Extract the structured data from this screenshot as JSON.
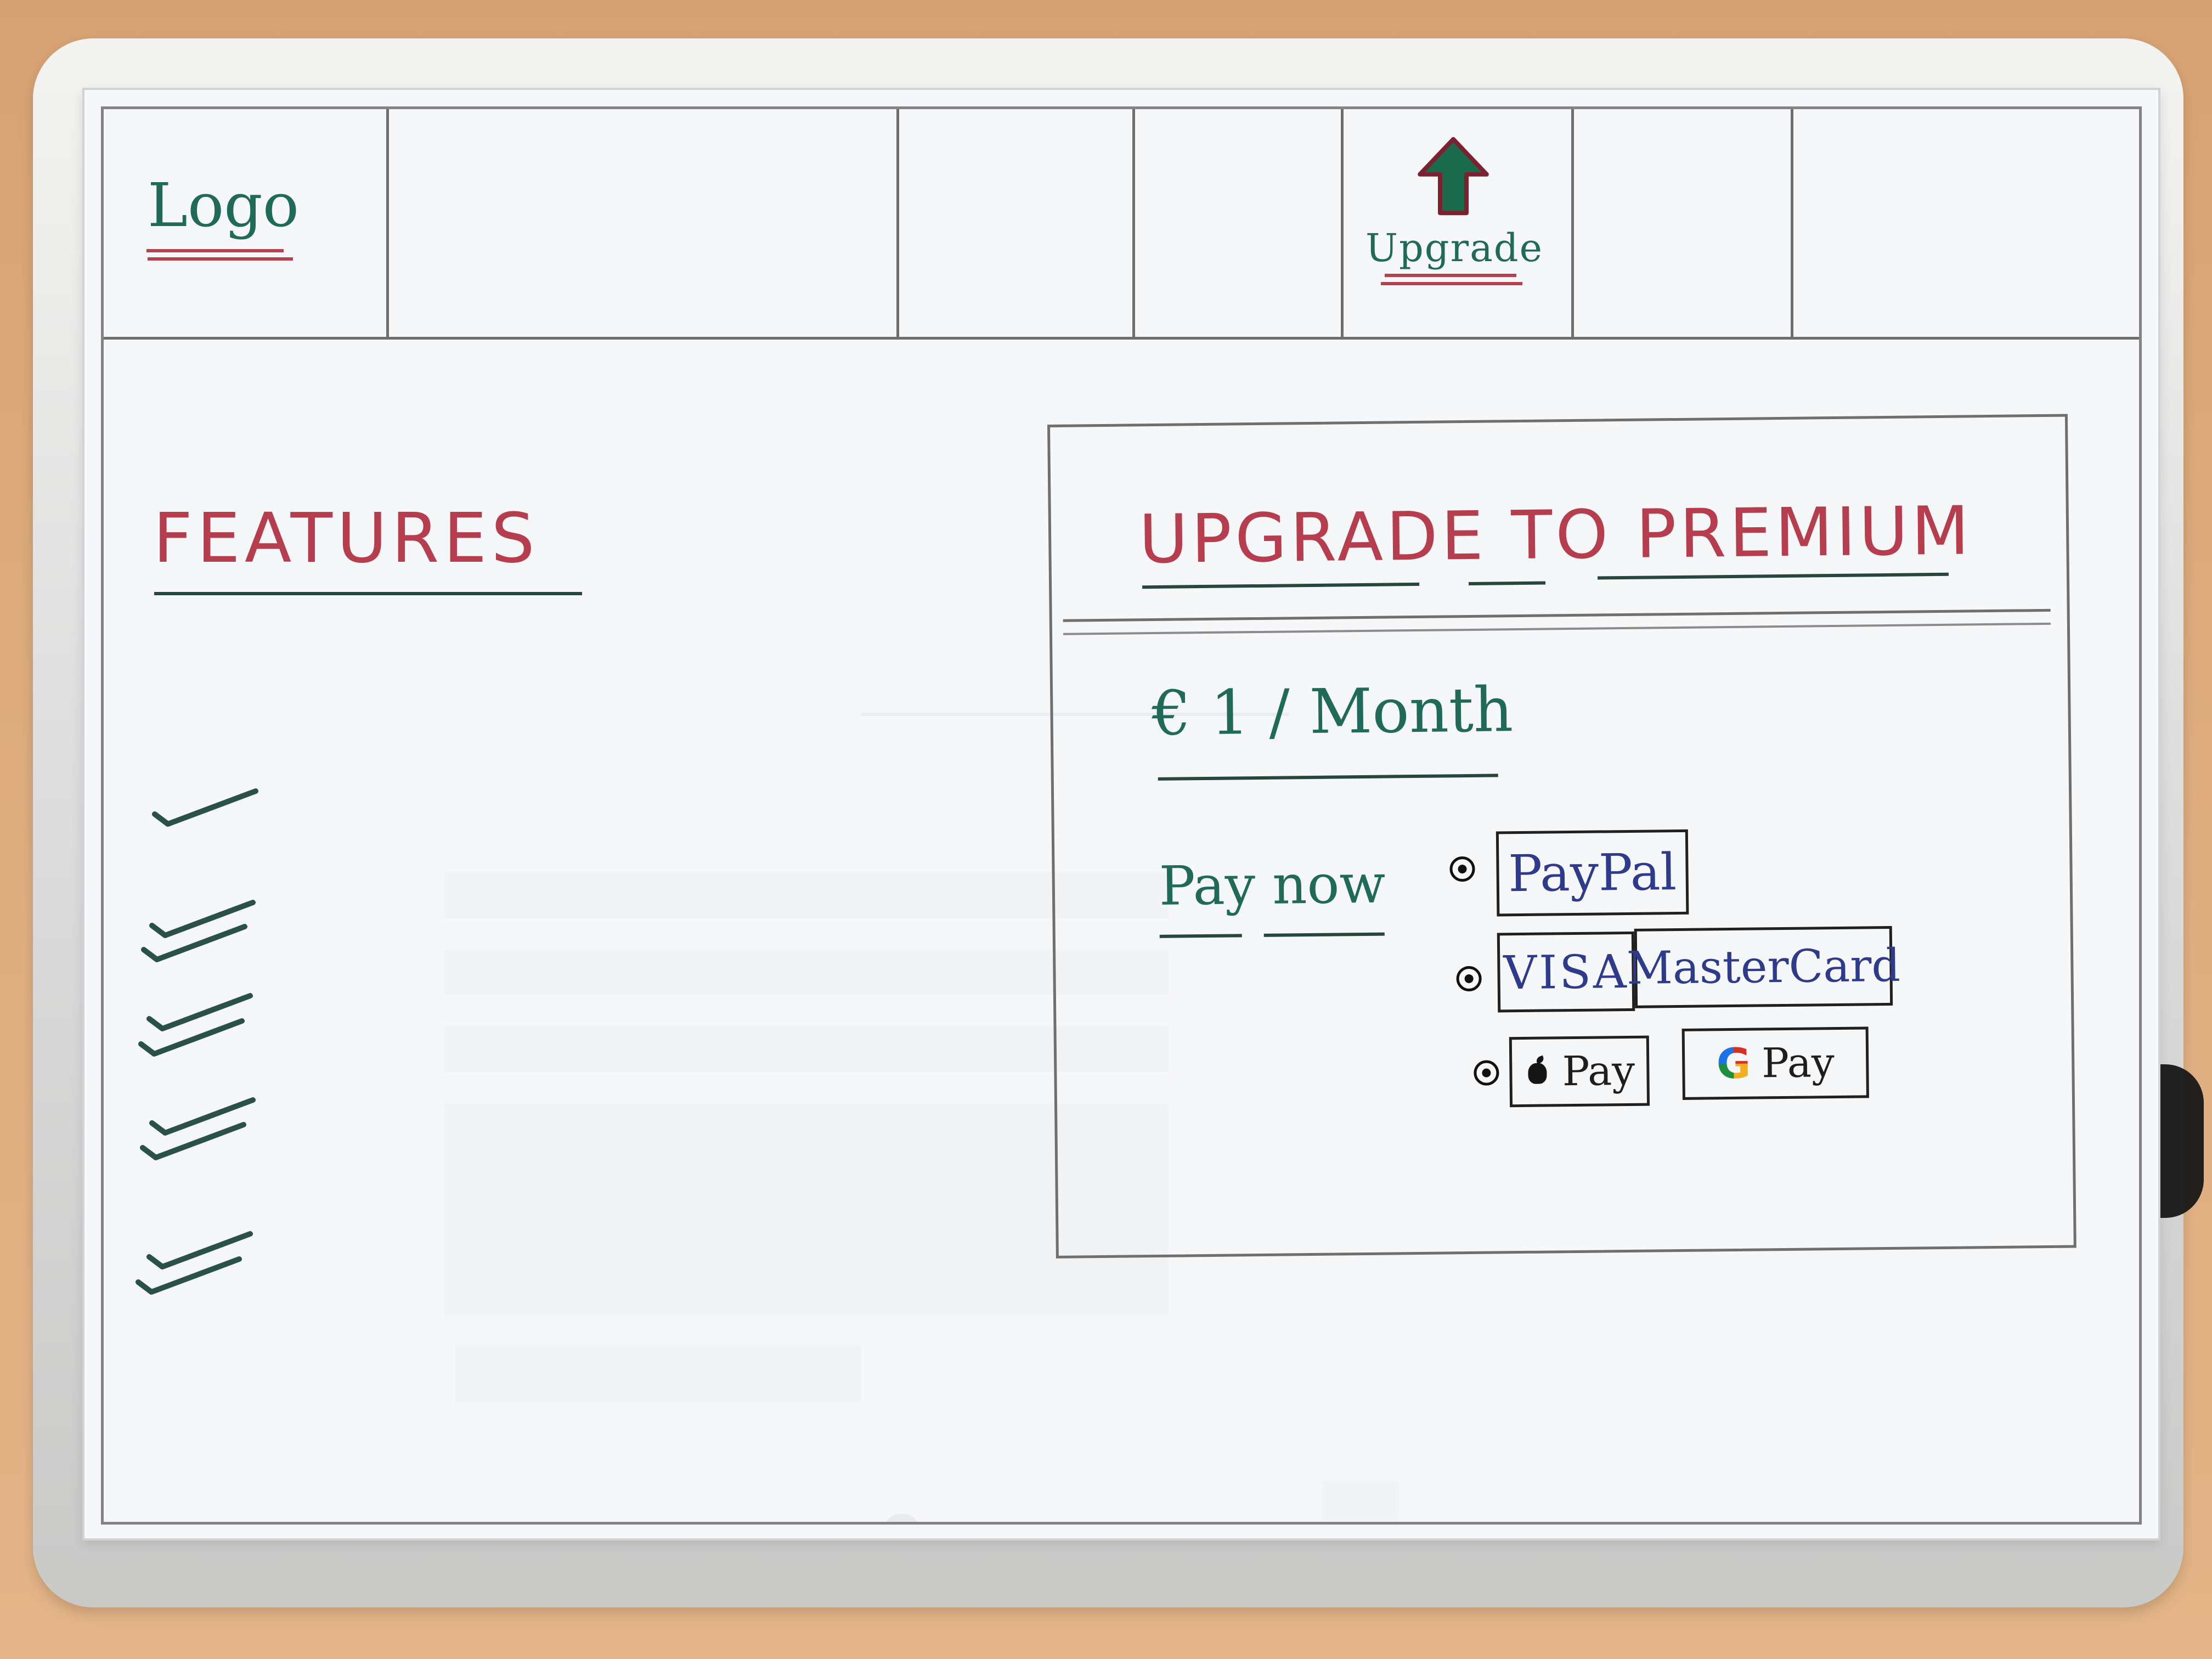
{
  "header": {
    "logo": "Logo",
    "upgrade_label": "Upgrade",
    "upgrade_icon": "up-arrow-icon"
  },
  "features": {
    "title": "FEATURES",
    "checkmarks": [
      "check",
      "check",
      "check",
      "check",
      "check",
      "check",
      "check",
      "check",
      "check"
    ]
  },
  "premium": {
    "title": "UPGRADE TO PREMIUM",
    "price": "€ 1 / Month",
    "pay_now": "Pay now",
    "options": {
      "paypal": "PayPal",
      "visa": "VISA",
      "mastercard": "MasterCard",
      "applepay": "Pay",
      "gpay_letter": "G",
      "gpay": "Pay"
    }
  },
  "colors": {
    "red_ink": "#b53d4d",
    "green_ink": "#1f6a59",
    "dark_ink": "#202020"
  }
}
